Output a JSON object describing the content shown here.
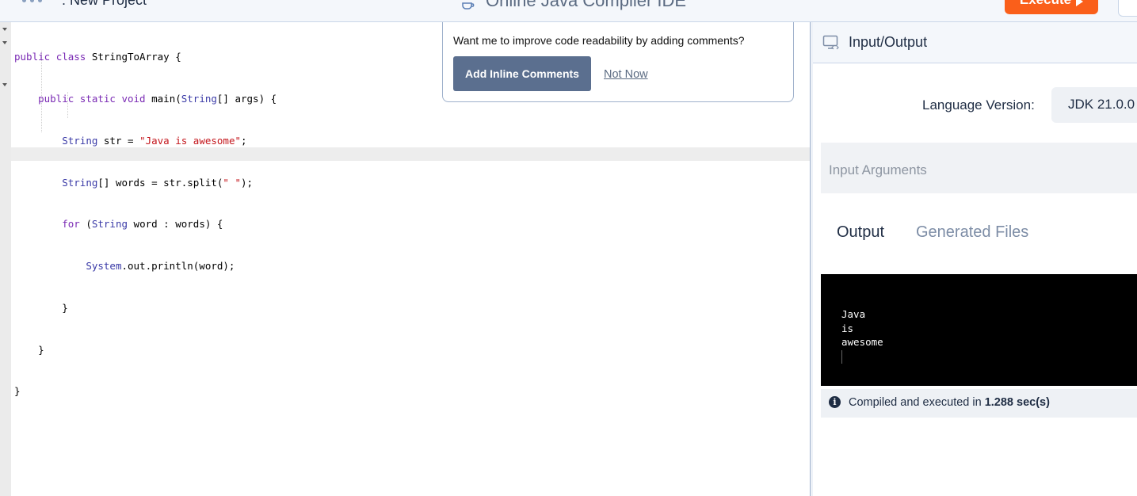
{
  "header": {
    "project_label": ": New Project",
    "ide_title": "Online Java Compiler IDE",
    "execute_label": "Execute"
  },
  "editor": {
    "lines": [
      "public class StringToArray {",
      "    public static void main(String[] args) {",
      "        String str = \"Java is awesome\";",
      "        String[] words = str.split(\" \");",
      "        for (String word : words) {",
      "            System.out.println(word);",
      "        }",
      "    }",
      "}"
    ]
  },
  "popup": {
    "question": "Want me to improve code readability by adding comments?",
    "add_label": "Add Inline Comments",
    "dismiss_label": "Not Now"
  },
  "panel": {
    "title": "Input/Output",
    "language_label": "Language Version:",
    "language_value": "JDK 21.0.0",
    "input_placeholder": "Input Arguments",
    "tabs": [
      {
        "label": "Output"
      },
      {
        "label": "Generated Files"
      }
    ],
    "output_lines": [
      "Java",
      "is",
      "awesome"
    ],
    "status_prefix": "Compiled and executed in",
    "status_time": "1.288 sec(s)"
  },
  "colors": {
    "accent": "#fa5f1a",
    "primary_button": "#5b6f8f",
    "text_dark": "#1f2d44",
    "terminal_bg": "#000000"
  }
}
